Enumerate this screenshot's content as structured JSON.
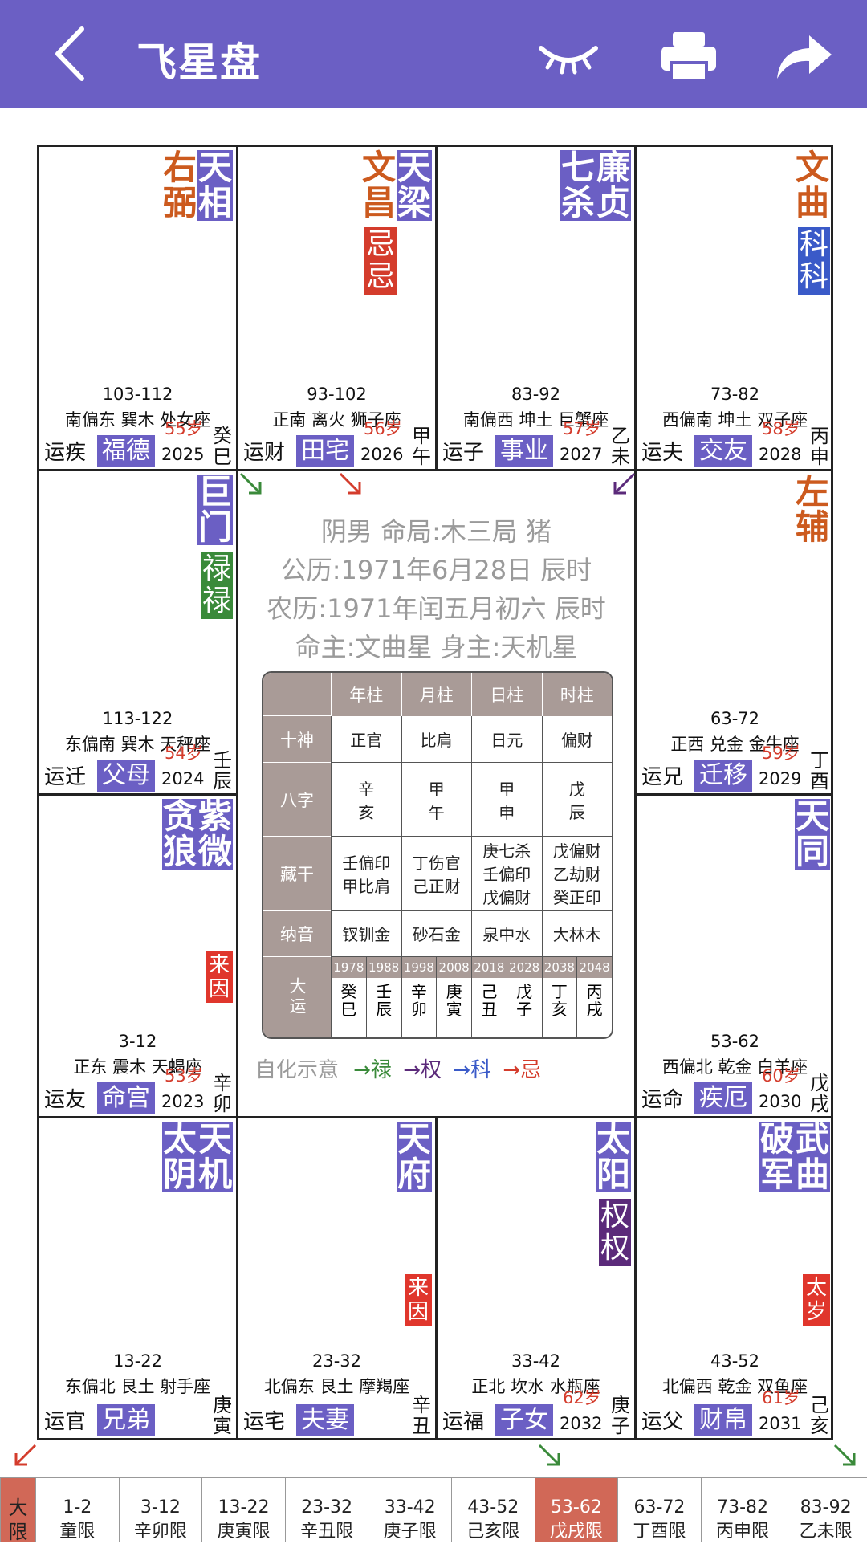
{
  "header": {
    "title": "飞星盘"
  },
  "colors": {
    "accent": "#6b5fc4",
    "orange": "#cc5a1e",
    "red": "#d43c2c",
    "green": "#3a8a3a",
    "blue": "#3a5ac8",
    "purple": "#5b2a7a"
  },
  "icons": {
    "back": "back-chevron-icon",
    "eye": "eye-closed-icon",
    "print": "printer-icon",
    "share": "share-icon"
  },
  "cells": [
    {
      "id": "c0",
      "stars_left": "右弼",
      "stars_right": "天相",
      "range": "103-112",
      "dir": "南偏东 巽木 处女座",
      "age": "55岁",
      "year": "2025",
      "gz": "癸巳",
      "yun": "运疾",
      "palace": "福德"
    },
    {
      "id": "c1",
      "stars_left": "文昌",
      "stars_right": "天梁",
      "badge": "忌忌",
      "range": "93-102",
      "dir": "正南 离火 狮子座",
      "age": "56岁",
      "year": "2026",
      "gz": "甲午",
      "yun": "运财",
      "palace": "田宅"
    },
    {
      "id": "c2",
      "stars_left": "七杀",
      "stars_right": "廉贞",
      "range": "83-92",
      "dir": "南偏西 坤土 巨蟹座",
      "age": "57岁",
      "year": "2027",
      "gz": "乙未",
      "yun": "运子",
      "palace": "事业"
    },
    {
      "id": "c3",
      "stars_right": "文曲",
      "badge": "科科",
      "range": "73-82",
      "dir": "西偏南 坤土 双子座",
      "age": "58岁",
      "year": "2028",
      "gz": "丙申",
      "yun": "运夫",
      "palace": "交友"
    },
    {
      "id": "c4",
      "stars_right": "巨门",
      "badge": "禄禄",
      "range": "113-122",
      "dir": "东偏南 巽木 天秤座",
      "age": "54岁",
      "year": "2024",
      "gz": "壬辰",
      "yun": "运迁",
      "palace": "父母"
    },
    {
      "id": "c5",
      "stars_right": "左辅",
      "range": "63-72",
      "dir": "正西 兑金 金牛座",
      "age": "59岁",
      "year": "2029",
      "gz": "丁酉",
      "yun": "运兄",
      "palace": "迁移"
    },
    {
      "id": "c6",
      "stars_left": "贪狼",
      "stars_right": "紫微",
      "laiyin": "来因",
      "range": "3-12",
      "dir": "正东 震木 天蝎座",
      "age": "53岁",
      "year": "2023",
      "gz": "辛卯",
      "yun": "运友",
      "palace": "命宫"
    },
    {
      "id": "c7",
      "stars_right": "天同",
      "range": "53-62",
      "dir": "西偏北 乾金 白羊座",
      "age": "60岁",
      "year": "2030",
      "gz": "戊戌",
      "yun": "运命",
      "palace": "疾厄"
    },
    {
      "id": "c8",
      "stars_left": "太阴",
      "stars_right": "天机",
      "range": "13-22",
      "dir": "东偏北 艮土 射手座",
      "gz": "庚寅",
      "yun": "运官",
      "palace": "兄弟"
    },
    {
      "id": "c9",
      "stars_right": "天府",
      "laiyin": "来因",
      "range": "23-32",
      "dir": "北偏东 艮土 摩羯座",
      "gz": "辛丑",
      "yun": "运宅",
      "palace": "夫妻"
    },
    {
      "id": "c10",
      "stars_right": "太阳",
      "badge": "权权",
      "range": "33-42",
      "dir": "正北 坎水 水瓶座",
      "age": "62岁",
      "year": "2032",
      "gz": "庚子",
      "yun": "运福",
      "palace": "子女"
    },
    {
      "id": "c11",
      "stars_left": "破军",
      "stars_right": "武曲",
      "taisui": "太岁",
      "range": "43-52",
      "dir": "北偏西 乾金 双鱼座",
      "age": "61岁",
      "year": "2031",
      "gz": "己亥",
      "yun": "运父",
      "palace": "财帛"
    }
  ],
  "center": {
    "line1": "阴男 命局:木三局 猪",
    "line2": "公历:1971年6月28日 辰时",
    "line3": "农历:1971年闰五月初六 辰时",
    "line4": "命主:文曲星 身主:天机星"
  },
  "bazi": {
    "cols": [
      "年柱",
      "月柱",
      "日柱",
      "时柱"
    ],
    "shishen_label": "十神",
    "shishen": [
      "正官",
      "比肩",
      "日元",
      "偏财"
    ],
    "bazi_label": "八字",
    "bazi": [
      "辛亥",
      "甲午",
      "甲申",
      "戊辰"
    ],
    "canggan_label": "藏干",
    "canggan": [
      "壬偏印\n甲比肩",
      "丁伤官\n己正财",
      "庚七杀\n壬偏印\n戊偏财",
      "戊偏财\n乙劫财\n癸正印"
    ],
    "nayin_label": "纳音",
    "nayin": [
      "钗钏金",
      "砂石金",
      "泉中水",
      "大林木"
    ],
    "dayun_label": "大运",
    "dayun_years": [
      "1978",
      "1988",
      "1998",
      "2008",
      "2018",
      "2028",
      "2038",
      "2048"
    ],
    "dayun_gz": [
      "癸巳",
      "壬辰",
      "辛卯",
      "庚寅",
      "己丑",
      "戊子",
      "丁亥",
      "丙戌"
    ]
  },
  "legend": {
    "label": "自化示意",
    "lu": "→禄",
    "quan": "→权",
    "ke": "→科",
    "ji": "→忌"
  },
  "bottom": {
    "first": "大限",
    "items": [
      {
        "range": "1-2",
        "gz": "童限"
      },
      {
        "range": "3-12",
        "gz": "辛卯限"
      },
      {
        "range": "13-22",
        "gz": "庚寅限"
      },
      {
        "range": "23-32",
        "gz": "辛丑限"
      },
      {
        "range": "33-42",
        "gz": "庚子限"
      },
      {
        "range": "43-52",
        "gz": "己亥限"
      },
      {
        "range": "53-62",
        "gz": "戊戌限",
        "active": true
      },
      {
        "range": "63-72",
        "gz": "丁酉限"
      },
      {
        "range": "73-82",
        "gz": "丙申限"
      },
      {
        "range": "83-92",
        "gz": "乙未限"
      }
    ]
  }
}
